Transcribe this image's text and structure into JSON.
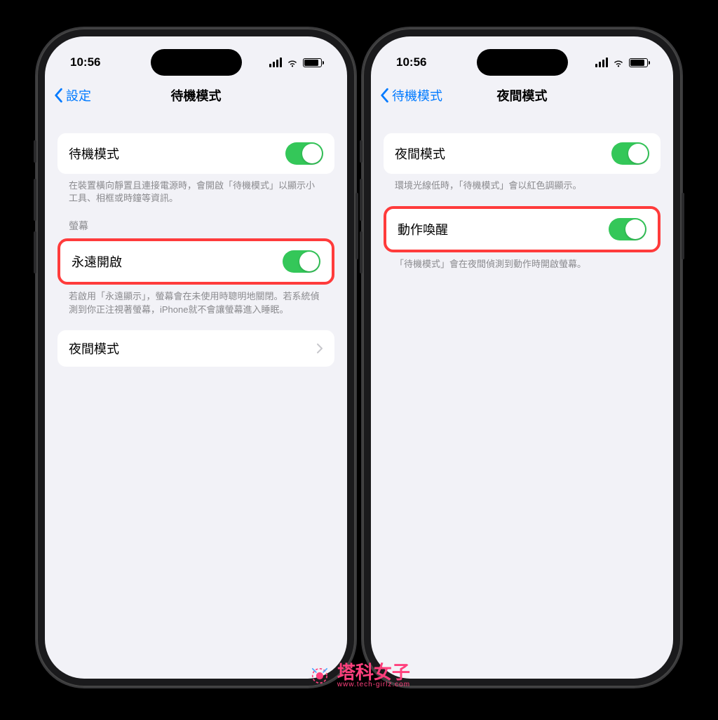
{
  "status": {
    "time": "10:56"
  },
  "left_phone": {
    "back_label": "設定",
    "title": "待機模式",
    "row1_label": "待機模式",
    "row1_footer": "在裝置橫向靜置且連接電源時，會開啟「待機模式」以顯示小工具、相框或時鐘等資訊。",
    "group2_header": "螢幕",
    "row2_label": "永遠開啟",
    "row2_footer": "若啟用「永遠顯示」，螢幕會在未使用時聰明地關閉。若系統偵測到你正注視著螢幕，iPhone就不會讓螢幕進入睡眠。",
    "row3_label": "夜間模式"
  },
  "right_phone": {
    "back_label": "待機模式",
    "title": "夜間模式",
    "row1_label": "夜間模式",
    "row1_footer": "環境光線低時，「待機模式」會以紅色調顯示。",
    "row2_label": "動作喚醒",
    "row2_footer": "「待機模式」會在夜間偵測到動作時開啟螢幕。"
  },
  "watermark": {
    "text": "塔科女子",
    "sub": "www.tech-girlz.com"
  }
}
